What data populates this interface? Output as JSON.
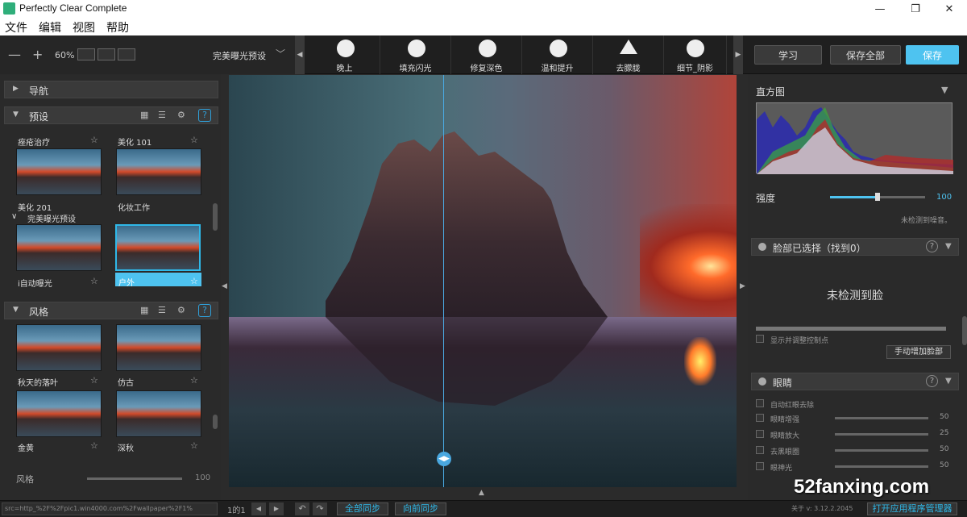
{
  "window": {
    "title": "Perfectly Clear Complete",
    "minimize": "—",
    "restore": "❐",
    "close": "✕"
  },
  "menu": [
    "文件",
    "编辑",
    "视图",
    "帮助"
  ],
  "toolbar": {
    "zoom_out": "—",
    "zoom_in": "+",
    "zoom_level": "60%",
    "preset_dropdown": "完美曝光预设",
    "tools": [
      "晚上",
      "填充闪光",
      "修复深色",
      "温和提升",
      "去朦胧",
      "细节_阴影"
    ],
    "learn": "学习",
    "save_all": "保存全部",
    "save": "保存"
  },
  "left": {
    "nav_title": "导航",
    "presets_title": "预设",
    "top_labels": [
      "痤疮治疗",
      "美化 101"
    ],
    "row1_labels": [
      "美化 201",
      "化妆工作"
    ],
    "group_label": "完美曝光预设",
    "row2_labels": [
      "i自动曝光",
      "户外"
    ],
    "style_title": "风格",
    "style_row1": [
      "秋天的落叶",
      "仿古"
    ],
    "style_row2": [
      "金黄",
      "深秋"
    ],
    "style_slider_label": "风格",
    "style_slider_value": "100",
    "help": "?"
  },
  "right": {
    "histogram_title": "直方图",
    "strength_label": "强度",
    "strength_value": "100",
    "strength_level": 0.5,
    "noise_note": "未检测到噪音。",
    "face_title": "脸部已选择（找到0）",
    "no_face": "未检测到脸",
    "show_adjust": "显示并调整控制点",
    "add_face": "手动增加脸部",
    "eyes_title": "眼睛",
    "eyes_items": [
      {
        "label": "自动红眼去除",
        "value": ""
      },
      {
        "label": "眼睛增强",
        "value": "50"
      },
      {
        "label": "眼睛放大",
        "value": "25"
      },
      {
        "label": "去黑眼圈",
        "value": "50"
      },
      {
        "label": "眼神光",
        "value": "50"
      }
    ],
    "help": "?"
  },
  "status": {
    "path": "src=http_%2F%2Fpic1.win4000.com%2Fwallpaper%2F1%",
    "page": "1的1",
    "sync_all": "全部同步",
    "sync_forward": "向前同步",
    "version_label": "关于 v: 3.12.2.2045",
    "open_manager": "打开应用程序管理器"
  },
  "watermark": "52fanxing.com",
  "colors": {
    "accent": "#2fb8e8",
    "save_button": "#4ec3f0"
  }
}
